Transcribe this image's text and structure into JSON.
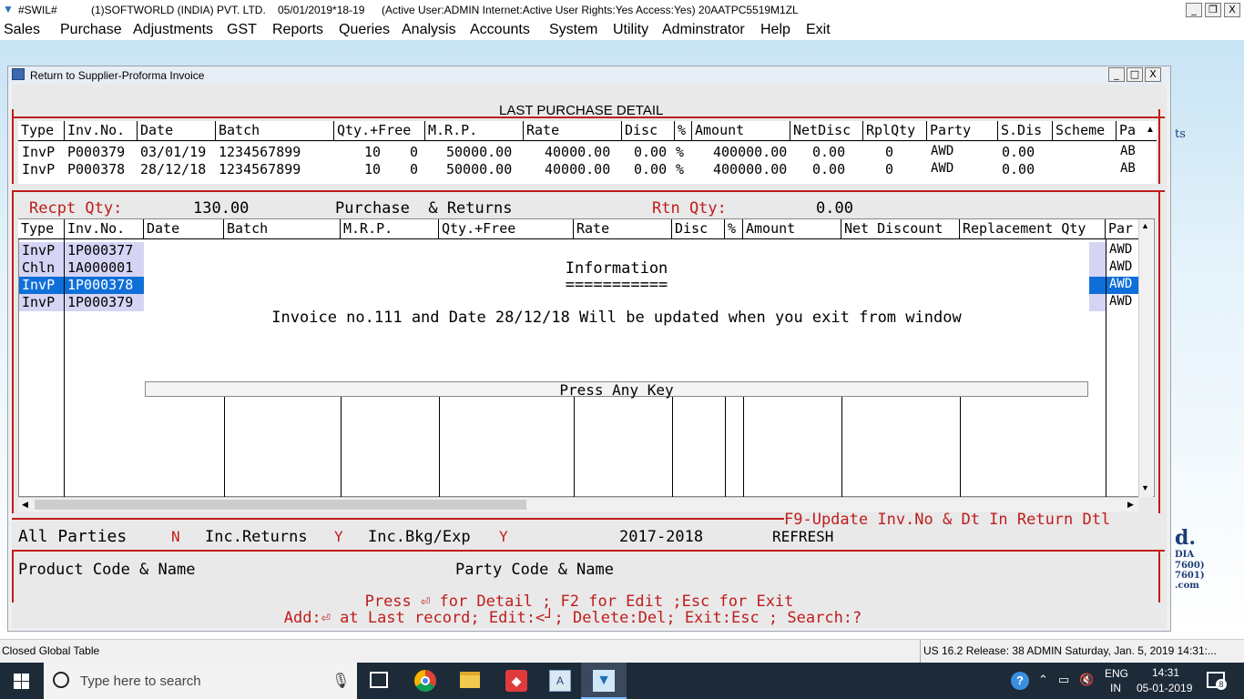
{
  "app": {
    "icon": "swil-logo-icon",
    "name": "#SWIL#",
    "company": "(1)SOFTWORLD (INDIA) PVT. LTD.",
    "date_code": "05/01/2019*18-19",
    "user_info": "(Active User:ADMIN Internet:Active  User Rights:Yes Access:Yes) 20AATPC5519M1ZL",
    "win_min": "_",
    "win_restore": "❐",
    "win_close": "X"
  },
  "menu": [
    "Sales",
    "Purchase",
    "Adjustments",
    "GST",
    "Reports",
    "Queries",
    "Analysis",
    "Accounts",
    "System",
    "Utility",
    "Adminstrator",
    "Help",
    "Exit"
  ],
  "window": {
    "title": "Return to Supplier-Proforma Invoice",
    "min": "_",
    "max": "□",
    "close": "X"
  },
  "last_purchase": {
    "heading": "LAST PURCHASE DETAIL",
    "headers": [
      "Type",
      "Inv.No.",
      "Date",
      "Batch",
      "Qty.+Free",
      "M.R.P.",
      "Rate",
      "Disc",
      "%",
      "Amount",
      "NetDisc",
      "RplQty",
      "Party",
      "S.Dis",
      "Scheme",
      "Pa"
    ],
    "rows": [
      {
        "type": "InvP",
        "inv": "P000379",
        "date": "03/01/19",
        "batch": "1234567899",
        "qty": "10",
        "free": "0",
        "mrp": "50000.00",
        "rate": "40000.00",
        "disc": "0.00",
        "pct": "%",
        "amount": "400000.00",
        "netdisc": "0.00",
        "rplqty": "0",
        "party": "AWD",
        "sdis": "0.00",
        "scheme": "",
        "pa": "AB"
      },
      {
        "type": "InvP",
        "inv": "P000378",
        "date": "28/12/18",
        "batch": "1234567899",
        "qty": "10",
        "free": "0",
        "mrp": "50000.00",
        "rate": "40000.00",
        "disc": "0.00",
        "pct": "%",
        "amount": "400000.00",
        "netdisc": "0.00",
        "rplqty": "0",
        "party": "AWD",
        "sdis": "0.00",
        "scheme": "",
        "pa": "AB"
      }
    ]
  },
  "summary": {
    "recpt_label": "Recpt Qty:",
    "recpt_value": "130.00",
    "purchase_returns": "Purchase  & Returns",
    "rtn_label": "Rtn Qty:",
    "rtn_value": "0.00"
  },
  "returns_table": {
    "headers": [
      "Type",
      "Inv.No.",
      "Date",
      "Batch",
      "M.R.P.",
      "Qty.+Free",
      "Rate",
      "Disc",
      "%",
      "Amount",
      "Net Discount",
      "Replacement Qty",
      "Par"
    ],
    "rows": [
      {
        "type": "InvP",
        "inv": "1P000377",
        "party": "AWD",
        "selected": false
      },
      {
        "type": "Chln",
        "inv": "1A000001",
        "party": "AWD",
        "selected": false
      },
      {
        "type": "InvP",
        "inv": "1P000378",
        "party": "AWD",
        "selected": true
      },
      {
        "type": "InvP",
        "inv": "1P000379",
        "party": "AWD",
        "selected": false
      }
    ]
  },
  "dialog": {
    "title": "Information",
    "underline": "===========",
    "message": "Invoice no.111 and Date 28/12/18 Will be updated when you exit from window",
    "footer": "Press Any Key"
  },
  "f9_hint": "F9-Update Inv.No & Dt In Return Dtl",
  "filters": {
    "all_parties_label": "All Parties",
    "all_parties_value": "N",
    "inc_returns_label": "Inc.Returns",
    "inc_returns_value": "Y",
    "inc_bkg_label": "Inc.Bkg/Exp",
    "inc_bkg_value": "Y",
    "year": "2017-2018",
    "refresh": "REFRESH"
  },
  "product_label": "Product Code & Name",
  "party_label": "Party Code & Name",
  "help_line1": "Press ⏎ for Detail ; F2 for Edit ;Esc for Exit",
  "help_line2": "Add:⏎ at Last record; Edit:<┘; Delete:Del; Exit:Esc ; Search:?",
  "side_text": {
    "ts": "ts",
    "d": "d.",
    "dia": "DIA",
    "n1": "7600)",
    "n2": "7601)",
    "com": ".com"
  },
  "status": {
    "left": "Closed Global Table",
    "right": "US 16.2 Release: 38 ADMIN  Saturday, Jan.  5, 2019  14:31:..."
  },
  "taskbar": {
    "search_placeholder": "Type here to search",
    "lang1": "ENG",
    "lang2": "IN",
    "time": "14:31",
    "date": "05-01-2019",
    "notif": "8"
  },
  "colors": {
    "accent_red": "#c01c1c",
    "selection": "#0f6fd8",
    "row_highlight": "#d6d4f4"
  }
}
